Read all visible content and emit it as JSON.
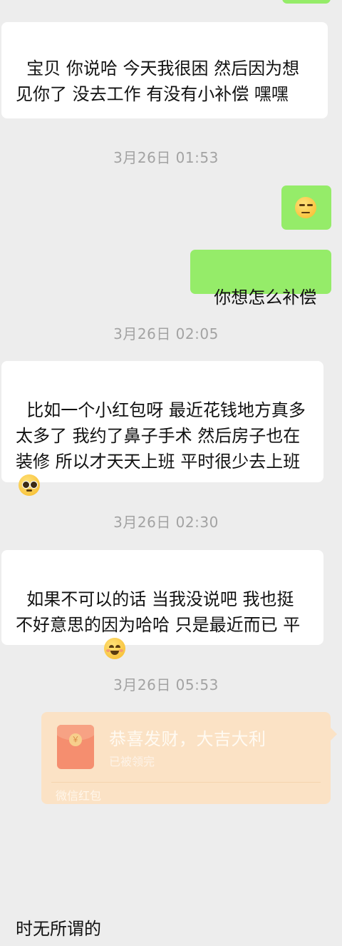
{
  "messages": [
    {
      "id": "m1",
      "text": "宝贝 你说哈 今天我很困 然后因为想见你了 没去工作 有没有小补偿 嘿嘿"
    },
    {
      "id": "m2",
      "emoji": "unamused-face"
    },
    {
      "id": "m3",
      "text": "你想怎么补偿"
    },
    {
      "id": "m4",
      "text": "比如一个小红包呀 最近花钱地方真多太多了 我约了鼻子手术 然后房子也在装修 所以才天天上班 平时很少去上班",
      "emoji": "pleading-face"
    },
    {
      "id": "m5",
      "text": "如果不可以的话 当我没说吧 我也挺不好意思的因为哈哈 只是最近而已 平时无所谓的",
      "emoji": "smiling-face"
    }
  ],
  "timestamps": [
    "3月26日 01:53",
    "3月26日 02:05",
    "3月26日 02:30",
    "3月26日 05:53"
  ],
  "red_packet": {
    "title": "恭喜发财，大吉大利",
    "status": "已被领完",
    "footer": "微信红包",
    "coin_symbol": "￥",
    "colors": {
      "card": "#fbe2c5",
      "icon": "#f58e6f"
    }
  },
  "colors": {
    "background": "#ededed",
    "sent_bubble": "#95ec69",
    "received_bubble": "#ffffff",
    "timestamp": "#a3a3a3"
  }
}
